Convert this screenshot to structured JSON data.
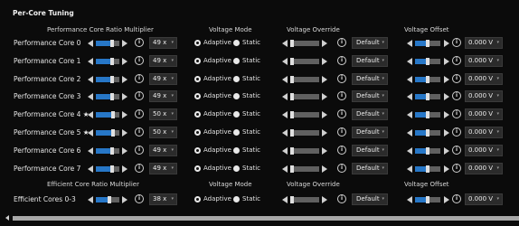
{
  "section_title": "Per-Core Tuning",
  "headers": {
    "perf_ratio": "Performance Core Ratio Multiplier",
    "voltage_mode": "Voltage Mode",
    "voltage_override": "Voltage Override",
    "voltage_offset": "Voltage Offset",
    "eff_ratio": "Efficient Core Ratio Multiplier",
    "voltage_mode_2": "Voltage Mode",
    "voltage_override_2": "Voltage Override",
    "voltage_offset_2": "Voltage Offset"
  },
  "radio_labels": {
    "adaptive": "Adaptive",
    "static": "Static"
  },
  "info_glyph": "i",
  "chevron_glyph": "▾",
  "accent_color": "#2777c7",
  "rows": [
    {
      "label": "Performance Core 0",
      "ratio": "49 x",
      "ratio_fill": 0.7,
      "mode": "Adaptive",
      "override": "Default",
      "offset": "0.000 V"
    },
    {
      "label": "Performance Core 1",
      "ratio": "49 x",
      "ratio_fill": 0.7,
      "mode": "Adaptive",
      "override": "Default",
      "offset": "0.000 V"
    },
    {
      "label": "Performance Core 2",
      "ratio": "49 x",
      "ratio_fill": 0.7,
      "mode": "Adaptive",
      "override": "Default",
      "offset": "0.000 V"
    },
    {
      "label": "Performance Core 3",
      "ratio": "49 x",
      "ratio_fill": 0.7,
      "mode": "Adaptive",
      "override": "Default",
      "offset": "0.000 V"
    },
    {
      "label": "Performance Core 4 ★",
      "ratio": "50 x",
      "ratio_fill": 0.72,
      "mode": "Adaptive",
      "override": "Default",
      "offset": "0.000 V"
    },
    {
      "label": "Performance Core 5 ★",
      "ratio": "50 x",
      "ratio_fill": 0.72,
      "mode": "Adaptive",
      "override": "Default",
      "offset": "0.000 V"
    },
    {
      "label": "Performance Core 6",
      "ratio": "49 x",
      "ratio_fill": 0.7,
      "mode": "Adaptive",
      "override": "Default",
      "offset": "0.000 V"
    },
    {
      "label": "Performance Core 7",
      "ratio": "49 x",
      "ratio_fill": 0.7,
      "mode": "Adaptive",
      "override": "Default",
      "offset": "0.000 V"
    }
  ],
  "eff_row": {
    "label": "Efficient Cores 0-3",
    "ratio": "38 x",
    "ratio_fill": 0.58,
    "mode": "Adaptive",
    "override": "Default",
    "offset": "0.000 V"
  }
}
